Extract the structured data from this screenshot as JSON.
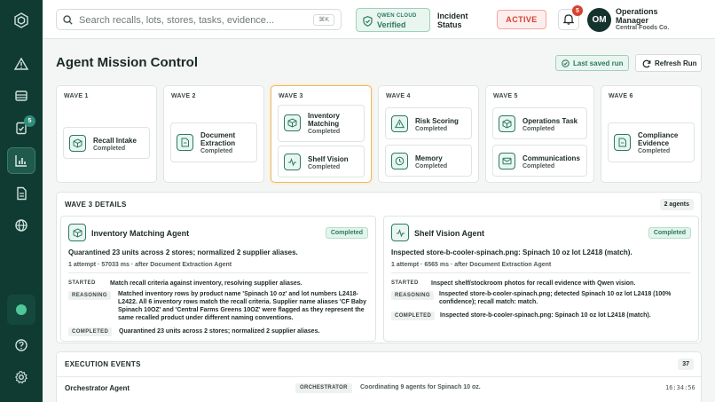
{
  "sidebar": {
    "items": [
      {
        "icon": "logo-icon"
      },
      {
        "icon": "alert-triangle-icon"
      },
      {
        "icon": "inbox-icon"
      },
      {
        "icon": "clipboard-check-icon",
        "badge": "5"
      },
      {
        "icon": "chart-icon",
        "active": true
      },
      {
        "icon": "document-icon"
      },
      {
        "icon": "globe-icon"
      },
      {
        "icon": "status-dot-icon"
      },
      {
        "icon": "help-icon"
      },
      {
        "icon": "settings-icon"
      }
    ],
    "badge": "5"
  },
  "header": {
    "search_placeholder": "Search recalls, lots, stores, tasks, evidence...",
    "search_shortcut": "⌘K",
    "verify_small": "QWEN CLOUD",
    "verify_big": "Verified",
    "incident_line1": "Incident",
    "incident_line2": "Status",
    "status_button": "ACTIVE",
    "notif_count": "5",
    "avatar_initials": "OM",
    "user_name": "Operations Manager",
    "user_org": "Central Foods Co."
  },
  "page": {
    "title": "Agent Mission Control",
    "last_saved": "Last saved run",
    "refresh": "Refresh Run"
  },
  "waves": [
    {
      "label": "WAVE 1",
      "agents": [
        {
          "name": "Recall Intake",
          "status": "Completed",
          "icon": "package-icon"
        }
      ]
    },
    {
      "label": "WAVE 2",
      "agents": [
        {
          "name": "Document Extraction",
          "status": "Completed",
          "icon": "file-icon"
        }
      ]
    },
    {
      "label": "WAVE 3",
      "agents": [
        {
          "name": "Inventory Matching",
          "status": "Completed",
          "icon": "package-icon"
        },
        {
          "name": "Shelf Vision",
          "status": "Completed",
          "icon": "activity-icon"
        }
      ]
    },
    {
      "label": "WAVE 4",
      "agents": [
        {
          "name": "Risk Scoring",
          "status": "Completed",
          "icon": "alert-triangle-icon"
        },
        {
          "name": "Memory",
          "status": "Completed",
          "icon": "clock-icon"
        }
      ]
    },
    {
      "label": "WAVE 5",
      "agents": [
        {
          "name": "Operations Task",
          "status": "Completed",
          "icon": "package-icon"
        },
        {
          "name": "Communications",
          "status": "Completed",
          "icon": "mail-icon"
        }
      ]
    },
    {
      "label": "WAVE 6",
      "agents": [
        {
          "name": "Compliance Evidence",
          "status": "Completed",
          "icon": "file-icon"
        }
      ]
    }
  ],
  "details": {
    "title": "WAVE 3 DETAILS",
    "agent_count": "2 agents",
    "cards": [
      {
        "name": "Inventory Matching Agent",
        "status": "Completed",
        "summary": "Quarantined 23 units across 2 stores; normalized 2 supplier aliases.",
        "meta": "1 attempt · 57033 ms · after Document Extraction Agent",
        "steps": [
          {
            "tag": "STARTED",
            "text": "Match recall criteria against inventory, resolving supplier aliases."
          },
          {
            "tag": "REASONING",
            "text": "Matched inventory rows by product name 'Spinach 10 oz' and lot numbers L2418-L2422. All 6 inventory rows match the recall criteria. Supplier name aliases 'CF Baby Spinach 10OZ' and 'Central Farms Greens 10OZ' were flagged as they represent the same recalled product under different naming conventions."
          },
          {
            "tag": "COMPLETED",
            "text": "Quarantined 23 units across 2 stores; normalized 2 supplier aliases."
          }
        ]
      },
      {
        "name": "Shelf Vision Agent",
        "status": "Completed",
        "summary": "Inspected store-b-cooler-spinach.png: Spinach 10 oz lot L2418 (match).",
        "meta": "1 attempt · 6565 ms · after Document Extraction Agent",
        "steps": [
          {
            "tag": "STARTED",
            "text": "Inspect shelf/stockroom photos for recall evidence with Qwen vision."
          },
          {
            "tag": "REASONING",
            "text": "Inspected store-b-cooler-spinach.png; detected Spinach 10 oz lot L2418 (100% confidence); recall match: match."
          },
          {
            "tag": "COMPLETED",
            "text": "Inspected store-b-cooler-spinach.png: Spinach 10 oz lot L2418 (match)."
          }
        ]
      }
    ]
  },
  "events": {
    "title": "EXECUTION EVENTS",
    "count": "37",
    "rows": [
      {
        "agent": "Orchestrator Agent",
        "tag": "ORCHESTRATOR",
        "message": "Coordinating 9 agents for Spinach 10 oz.",
        "time": "16:34:56"
      }
    ]
  }
}
